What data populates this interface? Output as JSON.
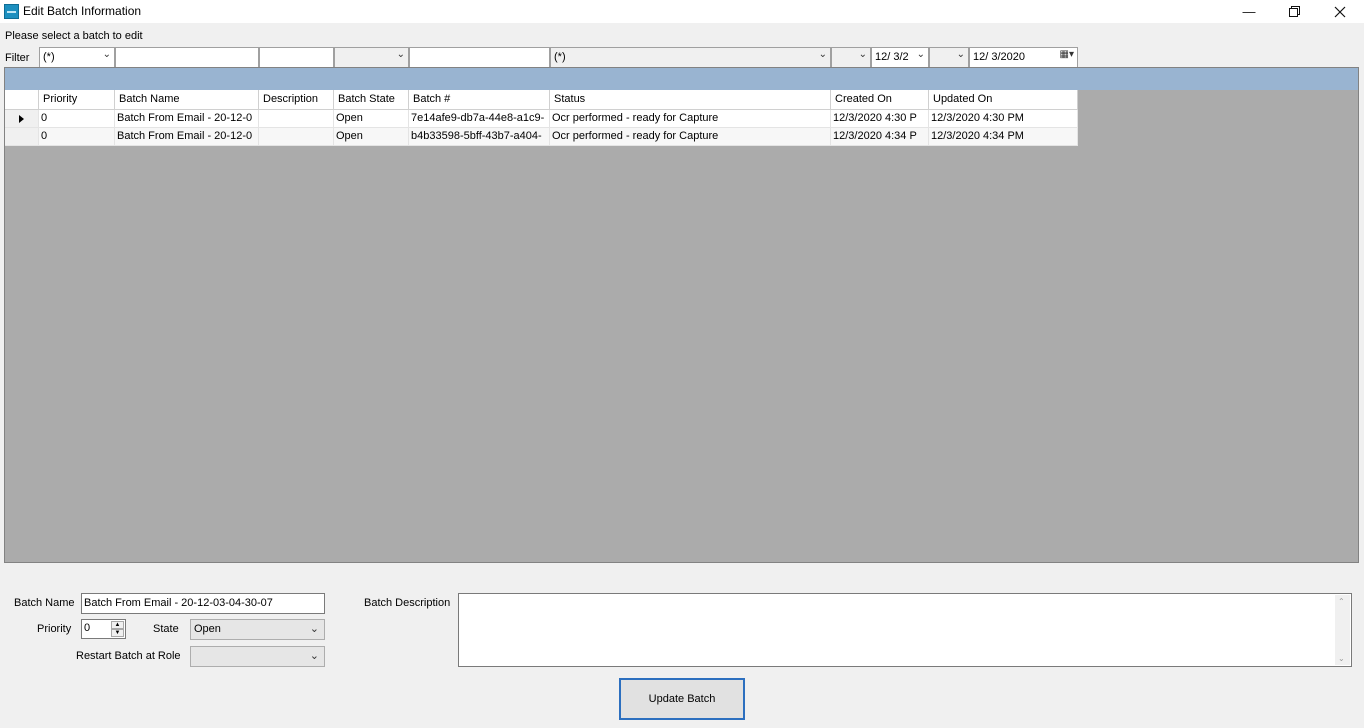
{
  "window": {
    "title": "Edit Batch Information",
    "minimize_icon": "minimize-icon",
    "restore_icon": "restore-icon",
    "close_icon": "close-icon"
  },
  "prompt": "Please select a batch to edit",
  "filter": {
    "label": "Filter",
    "priority": "(*)",
    "batch_name": "",
    "description": "",
    "batch_state": "",
    "batch_number": "",
    "status": "(*)",
    "created_on": "12/ 3/2",
    "updated_on": "12/  3/2020"
  },
  "grid": {
    "columns": [
      "Priority",
      "Batch Name",
      "Description",
      "Batch State",
      "Batch #",
      "Status",
      "Created On",
      "Updated On"
    ],
    "rows": [
      {
        "priority": "0",
        "batch_name": "Batch From Email - 20-12-0",
        "description": "",
        "batch_state": "Open",
        "batch_number": "7e14afe9-db7a-44e8-a1c9-",
        "status": "Ocr performed - ready for Capture",
        "created_on": "12/3/2020 4:30 P",
        "updated_on": "12/3/2020 4:30 PM"
      },
      {
        "priority": "0",
        "batch_name": "Batch From Email - 20-12-0",
        "description": "",
        "batch_state": "Open",
        "batch_number": "b4b33598-5bff-43b7-a404-",
        "status": "Ocr performed - ready for Capture",
        "created_on": "12/3/2020 4:34 P",
        "updated_on": "12/3/2020 4:34 PM"
      }
    ]
  },
  "form": {
    "batch_name_label": "Batch Name",
    "batch_name_value": "Batch From Email - 20-12-03-04-30-07",
    "priority_label": "Priority",
    "priority_value": "0",
    "state_label": "State",
    "state_value": "Open",
    "restart_label": "Restart Batch at Role",
    "restart_value": "",
    "description_label": "Batch Description",
    "description_value": ""
  },
  "update_button": "Update Batch",
  "colors": {
    "group_panel": "#99b4d1",
    "grid_background": "#ababab",
    "button_border": "#2c6fbf"
  }
}
